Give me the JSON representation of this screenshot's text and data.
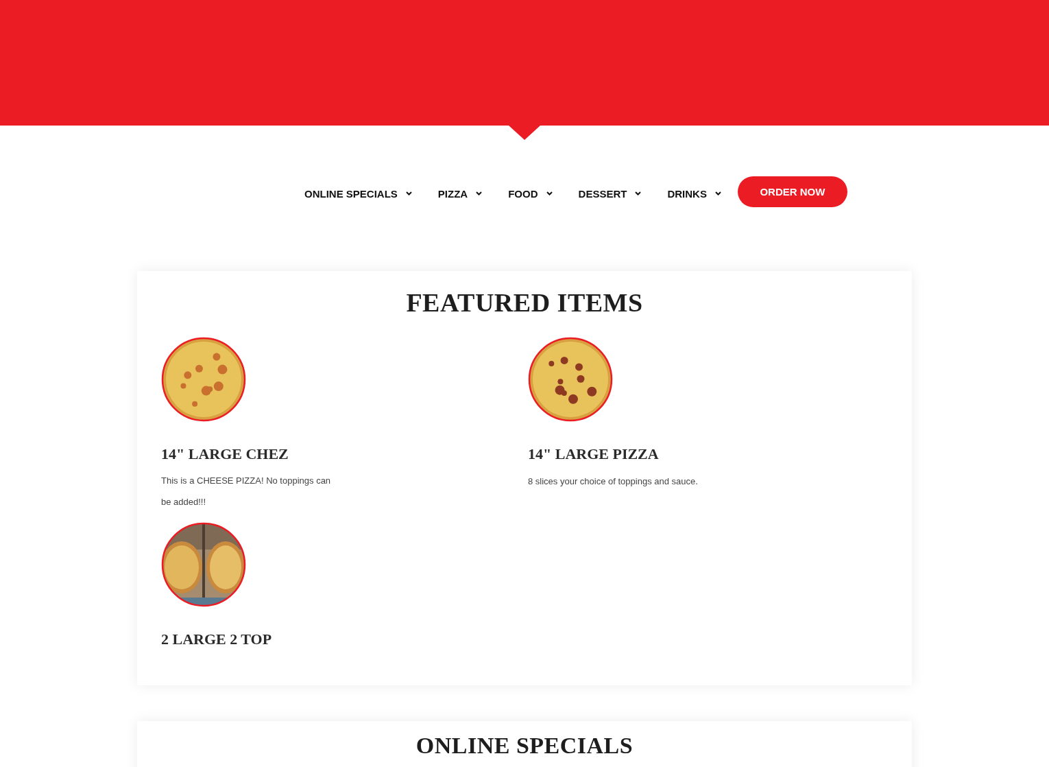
{
  "nav": {
    "items": [
      {
        "label": "ONLINE SPECIALS"
      },
      {
        "label": "PIZZA"
      },
      {
        "label": "FOOD"
      },
      {
        "label": "DESSERT"
      },
      {
        "label": "DRINKS"
      }
    ],
    "button": "ORDER NOW"
  },
  "featured": {
    "title": "FEATURED ITEMS",
    "items": [
      {
        "name": "14\" LARGE CHEZ",
        "description": "This is a CHEESE PIZZA! No toppings can be added!!!",
        "kind": "picture"
      },
      {
        "name": "14\" LARGE PIZZA",
        "description": "8 slices your choice of toppings and sauce.",
        "kind": "picture"
      },
      {
        "name": "2 LARGE 2 TOP",
        "kind": "picture"
      }
    ]
  },
  "specials": {
    "title": "ONLINE SPECIALS"
  }
}
